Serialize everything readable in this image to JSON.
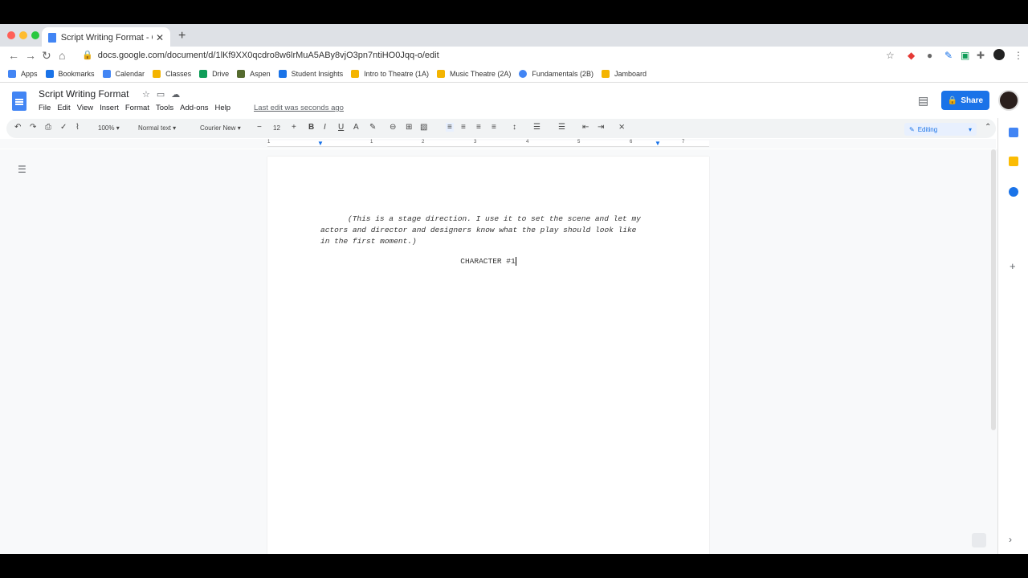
{
  "browser": {
    "tab_title": "Script Writing Format - Google",
    "url": "docs.google.com/document/d/1lKf9XX0qcdro8w6lrMuA5ABy8vjO3pn7ntiHO0Jqq-o/edit"
  },
  "bookmarks": [
    {
      "label": "Apps",
      "icon": "apps-grid-icon",
      "color": "#4285f4"
    },
    {
      "label": "Bookmarks",
      "icon": "star-icon",
      "color": "#1a73e8"
    },
    {
      "label": "Calendar",
      "icon": "calendar-icon",
      "color": "#4285f4"
    },
    {
      "label": "Classes",
      "icon": "classroom-icon",
      "color": "#f4b400"
    },
    {
      "label": "Drive",
      "icon": "drive-icon",
      "color": "#0f9d58"
    },
    {
      "label": "Aspen",
      "icon": "leaf-icon",
      "color": "#556b2f"
    },
    {
      "label": "Student Insights",
      "icon": "insights-icon",
      "color": "#1a73e8"
    },
    {
      "label": "Intro to Theatre (1A)",
      "icon": "folder-icon",
      "color": "#f4b400"
    },
    {
      "label": "Music Theatre (2A)",
      "icon": "folder-icon",
      "color": "#f4b400"
    },
    {
      "label": "Fundamentals (2B)",
      "icon": "google-icon",
      "color": "#4285f4"
    },
    {
      "label": "Jamboard",
      "icon": "jamboard-icon",
      "color": "#f4b400"
    }
  ],
  "doc": {
    "title": "Script Writing Format",
    "menu": [
      "File",
      "Edit",
      "View",
      "Insert",
      "Format",
      "Tools",
      "Add-ons",
      "Help"
    ],
    "last_edit": "Last edit was seconds ago",
    "share_label": "Share",
    "editing_label": "Editing"
  },
  "toolbar": {
    "zoom": "100%",
    "style": "Normal text",
    "font": "Courier New",
    "font_size": "12"
  },
  "ruler_numbers": [
    "1",
    "1",
    "2",
    "3",
    "4",
    "5",
    "6",
    "7"
  ],
  "page": {
    "stage_direction": "(This is a stage direction. I use it to set the scene and let my actors and director and designers know what the play should look like in the first moment.)",
    "character_name": "CHARACTER #1"
  },
  "colors": {
    "accent": "#1a73e8",
    "doc_blue": "#4285f4"
  }
}
